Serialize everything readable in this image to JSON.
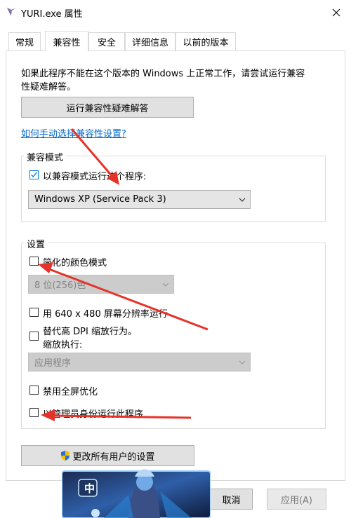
{
  "window": {
    "title": "YURI.exe 属性",
    "icon": "app-icon"
  },
  "tabs": [
    {
      "label": "常规"
    },
    {
      "label": "兼容性"
    },
    {
      "label": "安全"
    },
    {
      "label": "详细信息"
    },
    {
      "label": "以前的版本"
    }
  ],
  "intro": {
    "line1": "如果此程序不能在这个版本的 Windows 上正常工作，请尝试运行兼容",
    "line2": "性疑难解答。",
    "troubleshoot_button": "运行兼容性疑难解答",
    "manual_link": "如何手动选择兼容性设置?"
  },
  "compat_mode": {
    "legend": "兼容模式",
    "checkbox_label": "以兼容模式运行这个程序:",
    "checked": true,
    "selected_os": "Windows XP (Service Pack 3)"
  },
  "settings": {
    "legend": "设置",
    "reduced_color": "简化的颜色模式",
    "color_depth": "8 位(256)色",
    "res_640": "用 640 x 480 屏幕分辨率运行",
    "dpi_line1": "替代高 DPI 缩放行为。",
    "dpi_line2": "缩放执行:",
    "dpi_option": "应用程序",
    "fullscreen_opt": "禁用全屏优化",
    "run_as_admin": "以管理员身份运行此程序"
  },
  "change_all_button": "更改所有用户的设置",
  "footer": {
    "cancel": "取消",
    "apply": "应用(A)"
  },
  "banner": {
    "badge": "中"
  },
  "colors": {
    "accent": "#0078d7",
    "arrow": "#e5332a",
    "link": "#0066cc"
  }
}
